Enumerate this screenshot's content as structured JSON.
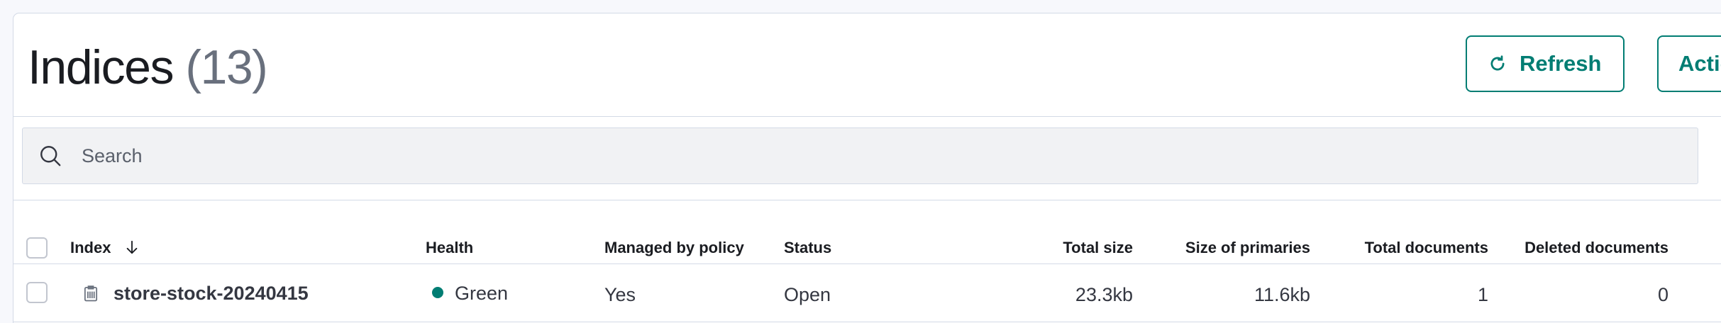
{
  "header": {
    "title": "Indices",
    "count": "(13)",
    "refresh_label": "Refresh",
    "actions_label": "Actions"
  },
  "search": {
    "placeholder": "Search",
    "value": ""
  },
  "table": {
    "columns": [
      "Index",
      "Health",
      "Managed by policy",
      "Status",
      "Total size",
      "Size of primaries",
      "Total documents",
      "Deleted documents"
    ],
    "rows": [
      {
        "index": "store-stock-20240415",
        "health": "Green",
        "managed": "Yes",
        "status": "Open",
        "total_size": "23.3kb",
        "primaries_size": "11.6kb",
        "total_docs": "1",
        "deleted_docs": "0"
      }
    ]
  },
  "colors": {
    "accent": "#017d73",
    "border": "#d3dae6",
    "health_green": "#017d73"
  },
  "icons": {
    "refresh": "refresh-icon",
    "search": "search-icon",
    "sort": "arrow-down-icon",
    "index_type": "clipboard-icon"
  }
}
